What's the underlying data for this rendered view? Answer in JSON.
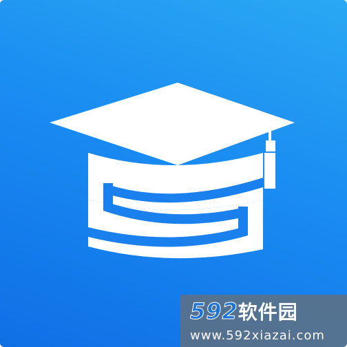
{
  "app_icon": {
    "name": "graduation-cap-s-logo",
    "background_colors": [
      "#2aa8f3",
      "#0f6fe6"
    ],
    "mark_color": "#ffffff",
    "stripe_color": "#1a80ee"
  },
  "watermark": {
    "brand_number": "592",
    "brand_text": "软件园",
    "url": "www.592xiazai.com",
    "number_color": "#1e74d6"
  }
}
